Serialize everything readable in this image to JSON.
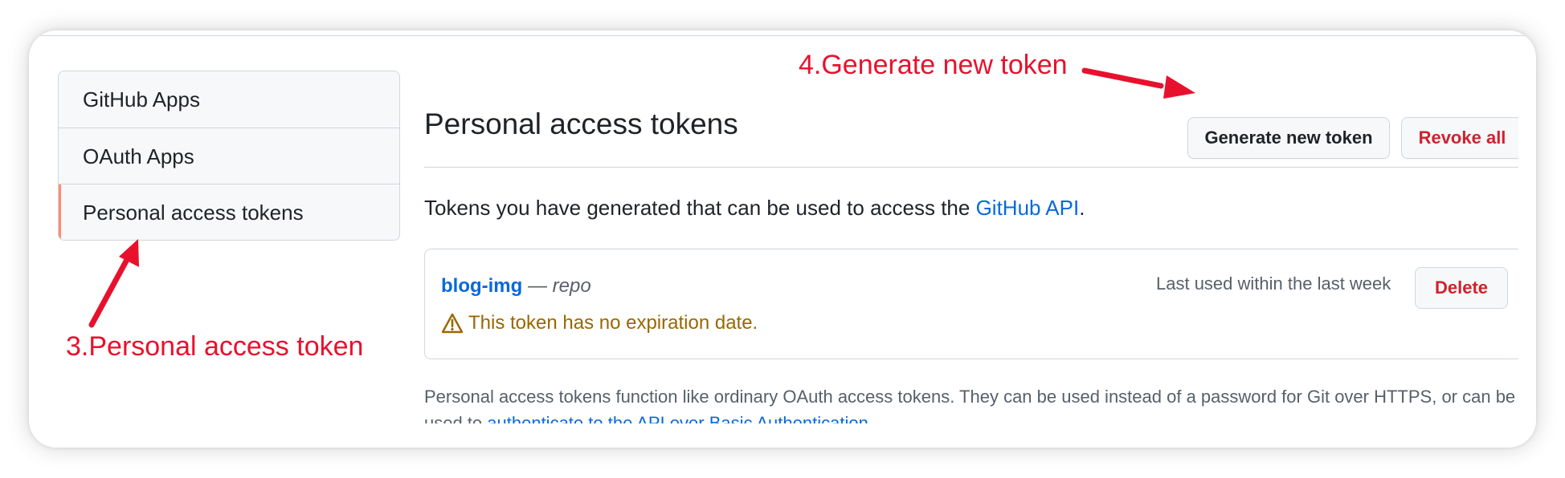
{
  "sidebar": {
    "items": [
      {
        "label": "GitHub Apps",
        "active": false
      },
      {
        "label": "OAuth Apps",
        "active": false
      },
      {
        "label": "Personal access tokens",
        "active": true
      }
    ]
  },
  "main": {
    "title": "Personal access tokens",
    "generate_label": "Generate new token",
    "revoke_label": "Revoke all",
    "intro_text": "Tokens you have generated that can be used to access the ",
    "intro_link": "GitHub API",
    "intro_end": "."
  },
  "token": {
    "name": "blog-img",
    "separator": " — ",
    "scope": "repo",
    "last_used": "Last used within the last week",
    "delete_label": "Delete",
    "warning": "This token has no expiration date."
  },
  "note": {
    "text": "Personal access tokens function like ordinary OAuth access tokens. They can be used instead of a password for Git over HTTPS, or can be used to ",
    "link": "authenticate to the API over Basic Authentication",
    "end": "."
  },
  "annotations": {
    "step3": "3.Personal access token",
    "step4": "4.Generate new token"
  },
  "colors": {
    "annotation": "#e8112d",
    "link": "#0969da",
    "danger": "#cf222e",
    "warning": "#9a6700",
    "active_marker": "#fd8c73"
  }
}
